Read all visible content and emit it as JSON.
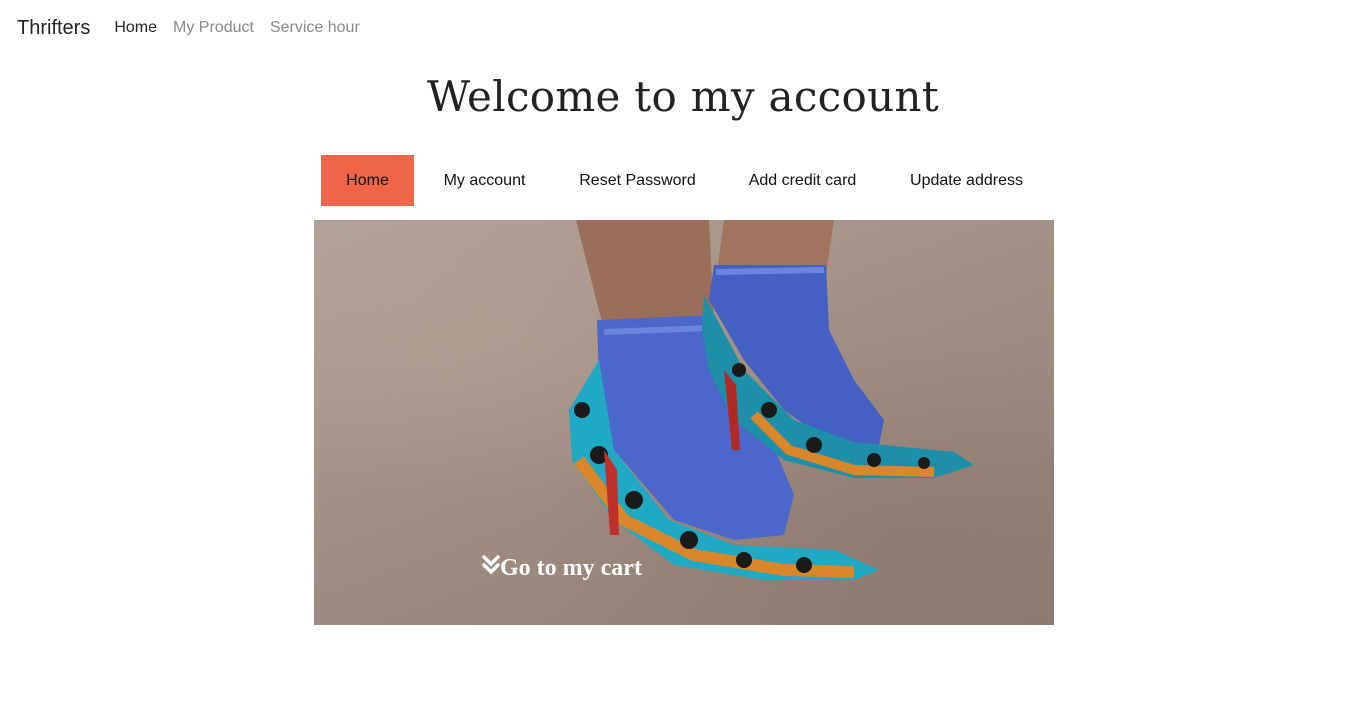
{
  "navbar": {
    "brand": "Thrifters",
    "links": [
      {
        "label": "Home"
      },
      {
        "label": "My Product"
      },
      {
        "label": "Service hour"
      }
    ]
  },
  "page": {
    "title": "Welcome to my account"
  },
  "account_tabs": [
    {
      "label": "Home",
      "active": true
    },
    {
      "label": "My account"
    },
    {
      "label": "Reset Password"
    },
    {
      "label": "Add credit card"
    },
    {
      "label": "Update address"
    }
  ],
  "hero": {
    "icon": "double-chevron-down-icon",
    "cta_label": "Go to my cart"
  },
  "colors": {
    "active_tab": "#f0654a",
    "sock": "#4a67c9",
    "shoe_teal": "#20a9c4",
    "shoe_orange": "#d9872a"
  }
}
